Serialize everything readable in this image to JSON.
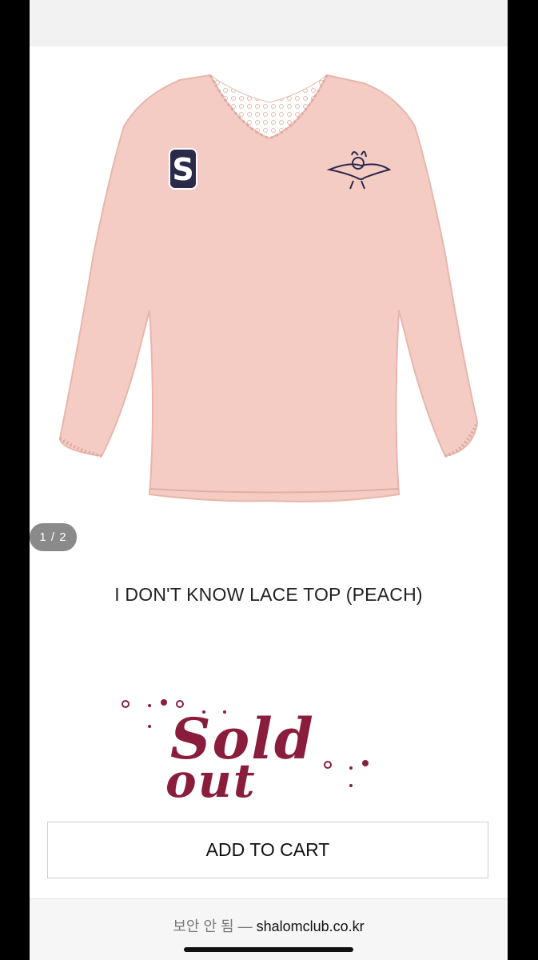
{
  "gallery": {
    "page_indicator": "1 / 2",
    "image_alt": "pink lace long-sleeve top with S patch and character embroidery",
    "colors": {
      "garment": "#f4ccc4",
      "garment_shade": "#e8b5ab",
      "patch": "#2c2a4a"
    }
  },
  "product": {
    "title": "I DON'T KNOW LACE TOP (PEACH)",
    "status_sold": "Sold",
    "status_out": "out",
    "status_color": "#8a1d3c"
  },
  "actions": {
    "add_to_cart_label": "ADD TO CART"
  },
  "browser": {
    "security_label": "보안 안 됨 —",
    "domain": "shalomclub.co.kr"
  }
}
